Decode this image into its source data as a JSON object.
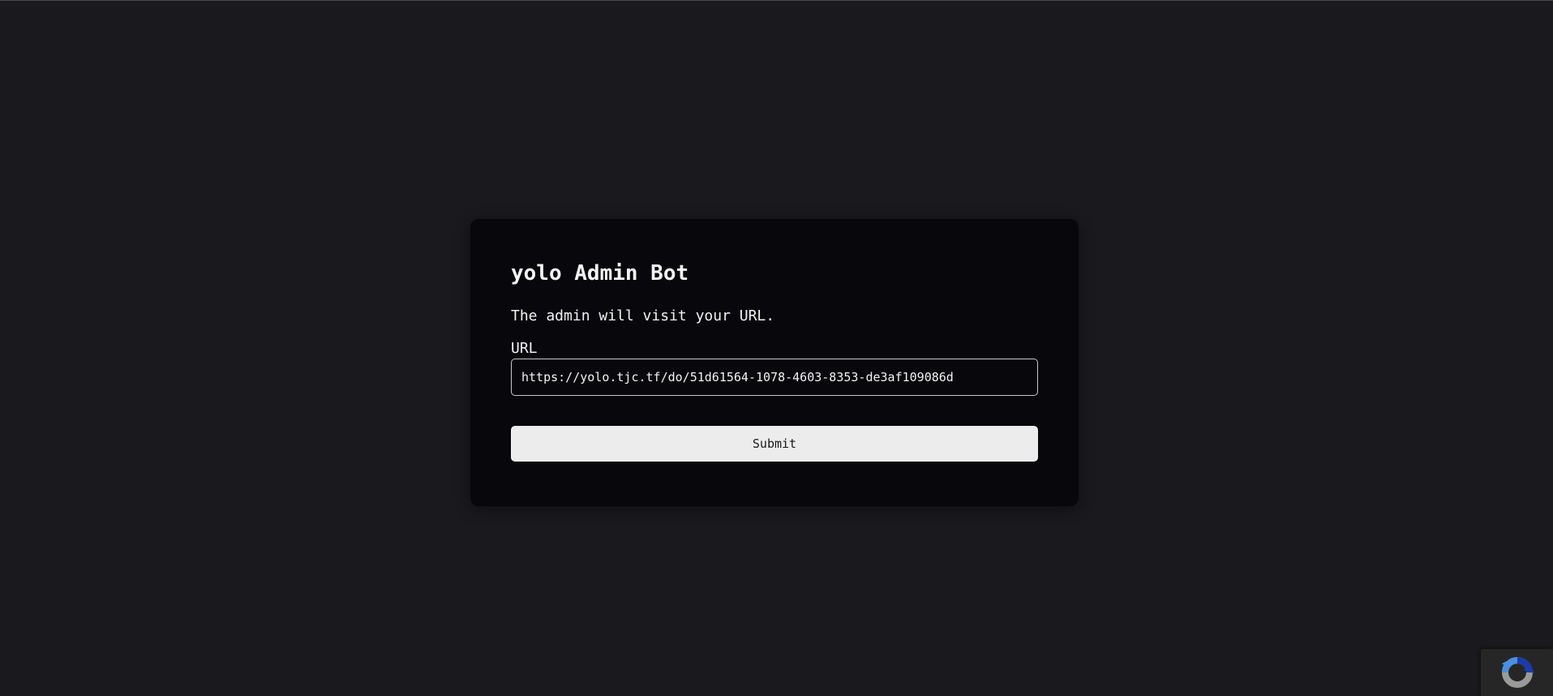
{
  "card": {
    "title": "yolo Admin Bot",
    "description": "The admin will visit your URL.",
    "url_label": "URL",
    "url_value": "https://yolo.tjc.tf/do/51d61564-1078-4603-8353-de3af109086d",
    "submit_label": "Submit"
  },
  "recaptcha": {
    "icon": "recaptcha-logo-icon"
  },
  "colors": {
    "page_background": "#1a191e",
    "card_background": "#08080c",
    "button_background": "#ececec"
  }
}
